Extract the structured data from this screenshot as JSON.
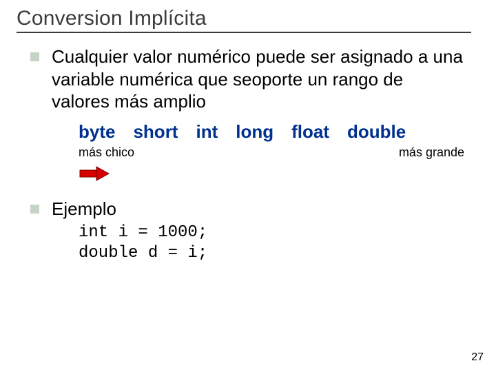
{
  "title": "Conversion Implícita",
  "bullets": {
    "main": "Cualquier valor numérico puede ser asignado a una variable numérica que seoporte un rango de valores más amplio",
    "ejemplo_label": "Ejemplo"
  },
  "types": {
    "byte": "byte",
    "short": "short",
    "int": "int",
    "long": "long",
    "float": "float",
    "double": "double"
  },
  "range": {
    "small": "más chico",
    "large": "más grande"
  },
  "code": {
    "line1": "int i = 1000;",
    "line2": "double d = i;"
  },
  "page_number": "27"
}
